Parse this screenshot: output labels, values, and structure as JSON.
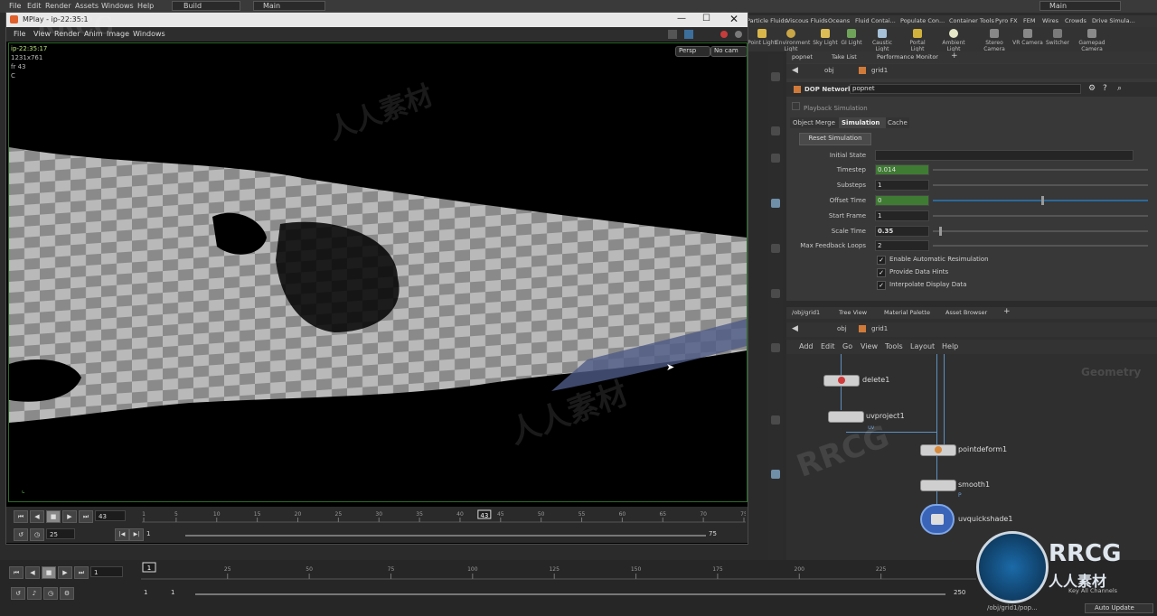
{
  "main_menu": [
    "File",
    "Edit",
    "Render",
    "Assets",
    "Windows",
    "Help"
  ],
  "desktop": {
    "name": "Build",
    "label": "Main"
  },
  "shelf_tabs": [
    "Particle Fluids",
    "Viscous Fluids",
    "Oceans",
    "Fluid Contai...",
    "Populate Con...",
    "Container Tools",
    "Pyro FX",
    "FEM",
    "Wires",
    "Crowds",
    "Drive Simula..."
  ],
  "shelf_tools": [
    "Point Light",
    "Environment Light",
    "Sky Light",
    "GI Light",
    "Caustic Light",
    "Portal Light",
    "Ambient Light",
    "Stereo Camera",
    "VR Camera",
    "Switcher",
    "Gamepad Camera"
  ],
  "mplay": {
    "title": "MPlay - ip-22:35:1",
    "menu": [
      "File",
      "View",
      "Render",
      "Anim",
      "Image",
      "Windows"
    ],
    "info": {
      "name": "ip-22:35:17",
      "resolution": "1231x761",
      "frame": "fr 43",
      "channel": "C"
    },
    "persp": "Persp",
    "cam": "No cam",
    "current_frame": "43",
    "fps": "25",
    "range_start": "1",
    "range_end": "75",
    "ticks": [
      "1",
      "5",
      "10",
      "15",
      "20",
      "25",
      "30",
      "35",
      "40",
      "45",
      "50",
      "55",
      "60",
      "65",
      "70",
      "75"
    ],
    "checker_progress": 0.57
  },
  "dop_panel": {
    "tabs": [
      "popnet",
      "Take List",
      "Performance Monitor"
    ],
    "path": [
      "obj",
      "grid1"
    ],
    "node_type": "DOP Network",
    "node_name": "popnet",
    "playback_label": "Playback Simulation",
    "param_tabs": [
      "Object Merge",
      "Simulation",
      "Cache"
    ],
    "reset_button": "Reset Simulation",
    "params": [
      {
        "label": "Initial State",
        "value": ""
      },
      {
        "label": "Timestep",
        "value": "0.014"
      },
      {
        "label": "Substeps",
        "value": "1"
      },
      {
        "label": "Offset Time",
        "value": "0"
      },
      {
        "label": "Start Frame",
        "value": "1"
      },
      {
        "label": "Scale Time",
        "value": "0.35"
      },
      {
        "label": "Max Feedback Loops",
        "value": "2"
      }
    ],
    "checkboxes": [
      "Enable Automatic Resimulation",
      "Provide Data Hints",
      "Interpolate Display Data"
    ]
  },
  "network": {
    "tabs": [
      "/obj/grid1",
      "Tree View",
      "Material Palette",
      "Asset Browser"
    ],
    "path": [
      "obj",
      "grid1"
    ],
    "menu": [
      "Add",
      "Edit",
      "Go",
      "View",
      "Tools",
      "Layout",
      "Help"
    ],
    "context_label": "Geometry",
    "nodes": [
      "delete1",
      "uvproject1",
      "pointdeform1",
      "smooth1",
      "uvquickshade1"
    ],
    "wire_labels": [
      "uv",
      "P"
    ]
  },
  "global_timeline": {
    "current_frame": "1",
    "ticks": [
      "25",
      "50",
      "75",
      "100",
      "125",
      "150",
      "175",
      "200",
      "225"
    ],
    "start": "1",
    "start2": "1",
    "end": "250",
    "end2": "250",
    "keys_label": "Key All Channels",
    "status_path": "/obj/grid1/pop...",
    "auto_update": "Auto Update"
  },
  "watermarks": [
    "RRCG",
    "人人素材",
    "RRCG",
    "人人素材"
  ],
  "colors": {
    "accent_green": "#3f7b33",
    "wire_blue": "#5d8fc0",
    "viewport_border": "#2f6a2a"
  }
}
